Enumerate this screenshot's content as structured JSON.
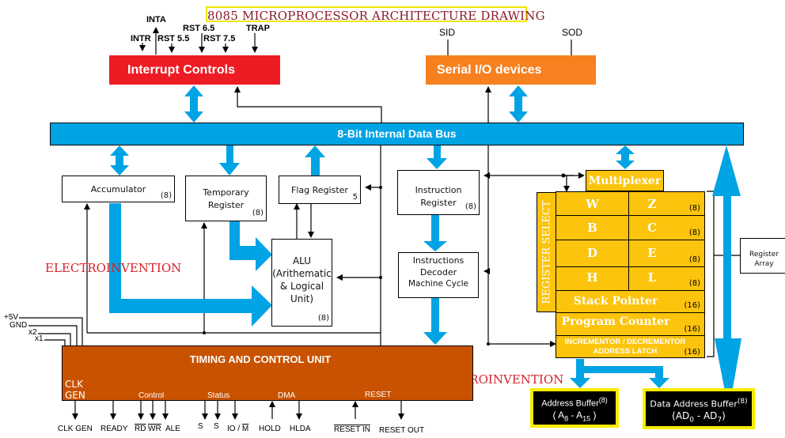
{
  "title": "8085 MICROPROCESSOR ARCHITECTURE DRAWING",
  "interrupts": {
    "block_label": "Interrupt Controls",
    "signals": [
      "INTA",
      "INTR",
      "RST 5.5",
      "RST 6.5",
      "RST 7.5",
      "TRAP"
    ]
  },
  "serial": {
    "block_label": "Serial I/O devices",
    "signals": [
      "SID",
      "SOD"
    ]
  },
  "data_bus": {
    "label": "8-Bit Internal Data Bus"
  },
  "accumulator": {
    "label": "Accumulator",
    "bits": "(8)"
  },
  "temp_register": {
    "line1": "Temporary",
    "line2": "Register",
    "bits": "(8)"
  },
  "flag_register": {
    "label": "Flag Register",
    "bits": "5"
  },
  "alu": {
    "line1": "ALU",
    "line2": "(Arithematic",
    "line3": "& Logical",
    "line4": "Unit)",
    "bits": "(8)"
  },
  "instruction_register": {
    "line1": "Instruction",
    "line2": "Register",
    "bits": "(8)"
  },
  "instruction_decoder": {
    "line1": "Instructions",
    "line2": "Decoder",
    "line3": "Machine Cycle"
  },
  "multiplexer": {
    "label": "Multiplexer"
  },
  "register_select": {
    "label": "REGISTER SELECT"
  },
  "registers": {
    "pairs": [
      {
        "left": "W",
        "right": "Z",
        "bits": "(8)"
      },
      {
        "left": "B",
        "right": "C",
        "bits": "(8)"
      },
      {
        "left": "D",
        "right": "E",
        "bits": "(8)"
      },
      {
        "left": "H",
        "right": "L",
        "bits": "(8)"
      }
    ],
    "stack_pointer": {
      "label": "Stack Pointer",
      "bits": "(16)"
    },
    "program_counter": {
      "label": "Program Counter",
      "bits": "(16)"
    },
    "inc_dec": {
      "line1": "INCREMENTOR / DECREMENTOR",
      "line2": "ADDRESS LATCH",
      "bits": "(16)"
    }
  },
  "register_array": {
    "line1": "Register",
    "line2": "Array"
  },
  "watermark": "ELECTROINVENTION",
  "power_inputs": [
    "+5V",
    "GND",
    "x2",
    "x1"
  ],
  "timing_control": {
    "title": "TIMING AND CONTROL UNIT",
    "clk_line1": "CLK",
    "clk_line2": "GEN",
    "groups": [
      "Control",
      "Status",
      "DMA",
      "RESET"
    ]
  },
  "bottom_pins": {
    "clk_gen": "CLK GEN",
    "ready": "READY",
    "rd": "RD",
    "wr": "WR",
    "ale": "ALE",
    "s0": "S",
    "s1": "S",
    "io": "IO / ",
    "m": "M",
    "hold": "HOLD",
    "hlda": "HLDA",
    "reset_in": "RESET IN",
    "reset_out": "RESET OUT"
  },
  "address_buffer": {
    "label": "Address Buffer",
    "sup": "(8)",
    "range_a": "( A",
    "sub_a": "8",
    "dash": " - A",
    "sub_b": "15",
    "close": " )"
  },
  "data_address_buffer": {
    "label": "Data Address Buffer",
    "sup": "(8)",
    "range_a": "(AD",
    "sub_a": "0",
    "dash": " - AD",
    "sub_b": "7",
    "close": ")"
  },
  "colors": {
    "interrupt_red": "#ed1c24",
    "serial_orange": "#f7801f",
    "bus_blue": "#00a3e4",
    "register_yellow": "#fcc40c",
    "timing_brown": "#c85200",
    "buffer_border": "#f7ec00",
    "watermark_red": "#d8202a",
    "title_text": "#8b1a2a"
  }
}
